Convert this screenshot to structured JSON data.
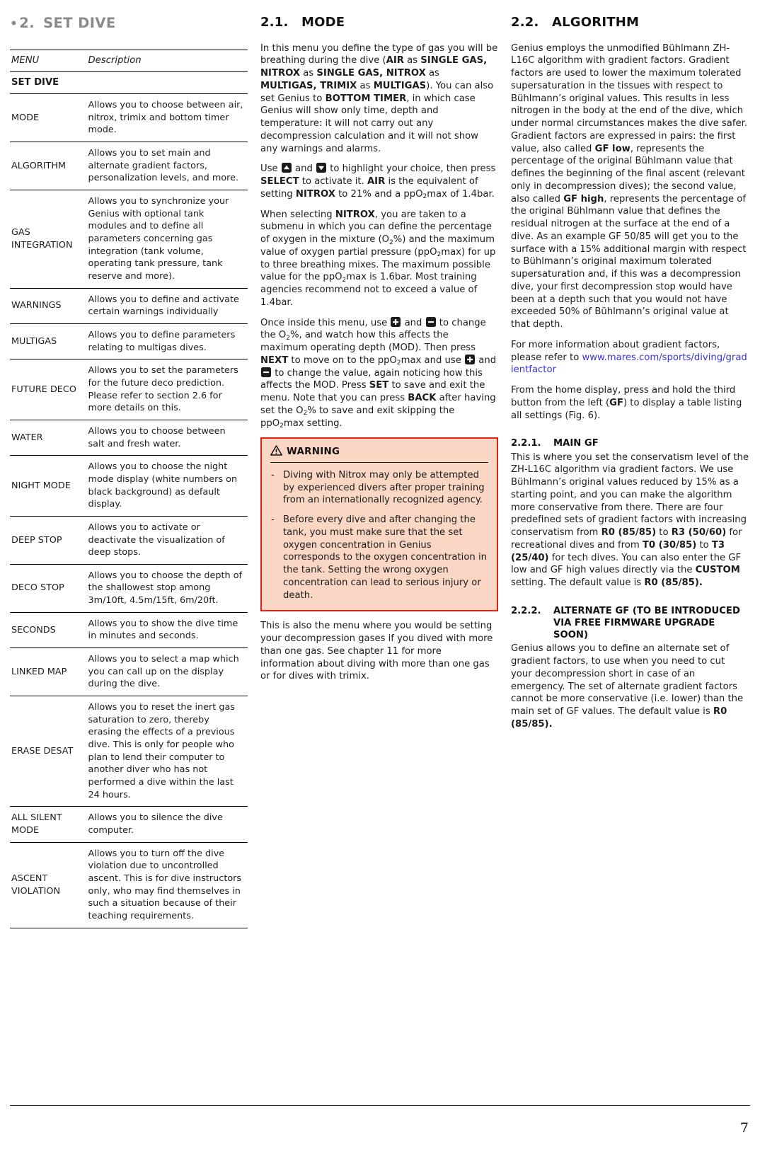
{
  "chapter": {
    "bullet": "•",
    "number": "2.",
    "title": "SET DIVE"
  },
  "table": {
    "headers": [
      "MENU",
      "Description"
    ],
    "section_label": "SET DIVE",
    "rows": [
      {
        "menu": "MODE",
        "desc": "Allows you to choose between air, nitrox, trimix and bottom timer mode."
      },
      {
        "menu": "ALGORITHM",
        "desc": "Allows you to set main and alternate gradient factors, personalization levels, and more."
      },
      {
        "menu": "GAS INTEGRATION",
        "desc": "Allows you to synchronize your Genius with optional tank modules and to define all parameters concerning gas integration (tank volume, operating tank pressure, tank reserve and more)."
      },
      {
        "menu": "WARNINGS",
        "desc": "Allows you to define and activate certain warnings individually"
      },
      {
        "menu": "MULTIGAS",
        "desc": "Allows you to define parameters relating to multigas dives."
      },
      {
        "menu": "FUTURE DECO",
        "desc": "Allows you to set the parameters for the future deco prediction. Please refer to section 2.6 for more details on this."
      },
      {
        "menu": "WATER",
        "desc": "Allows you to choose between salt and fresh water."
      },
      {
        "menu": "NIGHT MODE",
        "desc": "Allows you to choose the night mode display (white numbers on black background) as default display."
      },
      {
        "menu": "DEEP STOP",
        "desc": "Allows you to activate or deactivate the visualization of deep stops."
      },
      {
        "menu": "DECO STOP",
        "desc": "Allows you to choose the depth of the shallowest stop among 3m/10ft, 4.5m/15ft, 6m/20ft."
      },
      {
        "menu": "SECONDS",
        "desc": "Allows you to show the dive time in minutes and seconds."
      },
      {
        "menu": "LINKED MAP",
        "desc": "Allows you to select a map which you can call up on the display during the dive."
      },
      {
        "menu": "ERASE DESAT",
        "desc": "Allows you to reset the inert gas saturation to zero, thereby erasing the effects of a previous dive. This is only for people who plan to lend their computer to another diver who has not performed a dive within the last 24 hours."
      },
      {
        "menu": "ALL SILENT MODE",
        "desc": "Allows you to silence the dive computer."
      },
      {
        "menu": "ASCENT VIOLATION",
        "desc": "Allows you to turn off the dive violation due to uncontrolled ascent. This is for dive instructors only, who may find themselves in such a situation because of their teaching requirements."
      }
    ]
  },
  "mode_section": {
    "number": "2.1.",
    "title": "MODE",
    "p1_html": "In this menu you define the type of gas you will be breathing during the dive (<b>AIR</b> as <b>SINGLE GAS, NITROX</b> as <b>SINGLE GAS, NITROX</b> as <b>MULTIGAS, TRIMIX</b> as <b>MULTIGAS</b>). You can also set Genius to <b>BOTTOM TIMER</b>, in which case Genius will show only time, depth and temperature: it will not carry out any decompression calculation and it will not show any warnings and alarms.",
    "p2_html": "Use <span class=\"keyicon\" data-name=\"up-arrow-key-icon\"><svg width=\"14\" height=\"14\"><polygon points=\"7,3.6 11,9.2 3,9.2\" fill=\"#ffffff\"/></svg></span> and <span class=\"keyicon\" data-name=\"down-arrow-key-icon\"><svg width=\"14\" height=\"14\"><polygon points=\"7,10.4 3,4.8 11,4.8\" fill=\"#ffffff\"/></svg></span> to highlight your choice, then press <b>SELECT</b> to activate it. <b>AIR</b> is the equivalent of setting <b>NITROX</b> to 21% and a ppO<sub>2</sub>max of 1.4bar.",
    "p3_html": "When selecting <b>NITROX</b>, you are taken to a submenu in which you can define the percentage of oxygen in the mixture (O<sub>2</sub>%) and the maximum value of oxygen partial pressure (ppO<sub>2</sub>max) for up to three breathing mixes. The maximum possible value for the ppO<sub>2</sub>max is 1.6bar. Most training agencies recommend not to exceed a value of 1.4bar.",
    "p4_html": "Once inside this menu, use <span class=\"keyicon\" data-name=\"plus-key-icon\"><svg width=\"14\" height=\"14\"><rect x=\"6\" y=\"3\" width=\"2.2\" height=\"8\" fill=\"#ffffff\"/><rect x=\"3.1\" y=\"5.9\" width=\"8\" height=\"2.2\" fill=\"#ffffff\"/></svg></span> and <span class=\"keyicon\" data-name=\"minus-key-icon\"><svg width=\"14\" height=\"14\"><rect x=\"3.1\" y=\"5.9\" width=\"8\" height=\"2.2\" fill=\"#ffffff\"/></svg></span> to change the O<sub>2</sub>%, and watch how this affects the maximum operating depth (MOD). Then press <b>NEXT</b> to move on to the ppO<sub>2</sub>max and use <span class=\"keyicon\" data-name=\"plus-key-icon\"><svg width=\"14\" height=\"14\"><rect x=\"6\" y=\"3\" width=\"2.2\" height=\"8\" fill=\"#ffffff\"/><rect x=\"3.1\" y=\"5.9\" width=\"8\" height=\"2.2\" fill=\"#ffffff\"/></svg></span> and <span class=\"keyicon\" data-name=\"minus-key-icon\"><svg width=\"14\" height=\"14\"><rect x=\"3.1\" y=\"5.9\" width=\"8\" height=\"2.2\" fill=\"#ffffff\"/></svg></span> to change the value, again noticing how this affects the MOD. Press <b>SET</b> to save and exit the menu. Note that you can press <b>BACK</b> after having set the O<sub>2</sub>% to save and exit skipping the ppO<sub>2</sub>max setting.",
    "p5_html": "This is also the menu where you would be setting your decompression gases if you dived with more than one gas. See chapter 11 for more information about diving with more than one gas or for dives with trimix."
  },
  "warning": {
    "icon": "warning-triangle-icon",
    "label": "WARNING",
    "border_color": "#e01f14",
    "background_color": "#f9d7c4",
    "items": [
      "Diving with Nitrox may only be attempted by experienced divers after proper training from an internationally recognized agency.",
      "Before every dive and after changing the tank, you must make sure that the set oxygen concentration in Genius corresponds to the oxygen concentration in the tank. Setting the wrong oxygen concentration can lead to serious injury or death."
    ],
    "bullet_dash": "-"
  },
  "algorithm_section": {
    "number": "2.2.",
    "title": "ALGORITHM",
    "p1_html": "Genius employs the unmodified B&uuml;hlmann ZH-L16C algorithm with gradient factors. Gradient factors are used to lower the maximum tolerated supersaturation in the tissues with respect to B&uuml;hlmann&rsquo;s original values. This results in less nitrogen in the body at the end of the dive, which under normal circumstances makes the dive safer. Gradient factors are expressed in pairs: the first value, also called <b>GF low</b>, represents the percentage of the original B&uuml;hlmann value that defines the beginning of the final ascent (relevant only in decompression dives); the second value, also called <b>GF high</b>, represents the percentage of the original B&uuml;hlmann value that defines the residual nitrogen at the surface at the end of a dive. As an example GF 50/85 will get you to the surface with a 15% additional margin with respect to B&uuml;hlmann&rsquo;s original maximum tolerated supersaturation and, if this was a decompression dive, your first decompression stop would have been at a depth such that you would not have exceeded 50% of B&uuml;hlmann&rsquo;s original value at that depth.",
    "p2_prefix": "For more information about gradient factors, please refer to ",
    "link_text": "www.mares.com/sports/diving/gradientfactor",
    "link_color": "#3535d8",
    "p3_html": "From the home display, press and hold the third button from the left (<b>GF</b>) to display a table listing all settings (Fig. 6)."
  },
  "main_gf": {
    "number": "2.2.1.",
    "title": "MAIN GF",
    "body_html": "This is where you set the conservatism level of the ZH-L16C algorithm via gradient factors. We use B&uuml;hlmann&rsquo;s original values reduced by 15% as a starting point, and you can make the algorithm more conservative from there. There are four predefined sets of gradient factors with increasing conservatism from <b>R0 (85/85)</b> to <b>R3 (50/60)</b> for recreational dives and from <b>T0 (30/85)</b> to <b>T3 (25/40)</b> for tech dives. You can also enter the GF low and GF high values directly via the <b>CUSTOM</b> setting. The default value is <b>R0 (85/85).</b>"
  },
  "alternate_gf": {
    "number": "2.2.2.",
    "title": "ALTERNATE GF (TO BE INTRODUCED VIA FREE FIRMWARE UPGRADE SOON)",
    "body_html": "Genius allows you to define an alternate set of gradient factors, to use when you need to cut your decompression short in case of an emergency. The set of alternate gradient factors cannot be more conservative (i.e. lower) than the main set of GF values. The default value is <b>R0 (85/85).</b>"
  },
  "footer": {
    "page_number": "7"
  }
}
